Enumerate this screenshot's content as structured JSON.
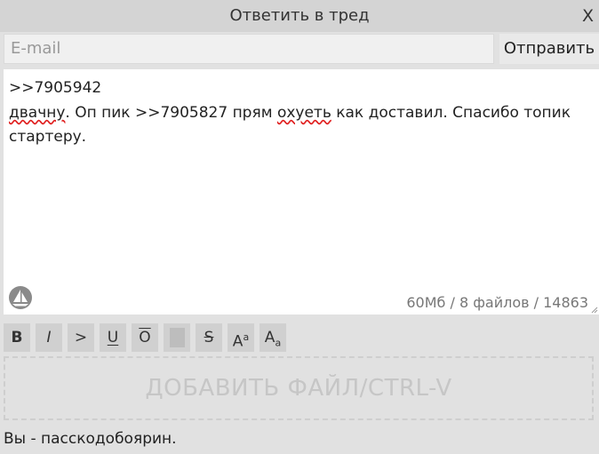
{
  "window": {
    "title": "Ответить в тред",
    "close_label": "X"
  },
  "form": {
    "email_placeholder": "E-mail",
    "email_value": "",
    "send_label": "Отправить",
    "comment": {
      "line1": ">>7905942",
      "word_misspelled_1": "двачну",
      "part2": ". Оп пик >>7905827 прям ",
      "word_misspelled_2": "охуеть",
      "part3": " как доставил. Спасибо топик стартеру."
    },
    "counter": "60Мб / 8 файлов / 14863"
  },
  "toolbar": {
    "bold": "B",
    "italic": "I",
    "quote": ">",
    "underline": "U",
    "overline": "O",
    "spoiler": "",
    "strike": "S",
    "sup_base": "A",
    "sup_mark": "a",
    "sub_base": "A",
    "sub_mark": "a"
  },
  "upload": {
    "label": "ДОБАВИТЬ ФАЙЛ/CTRL-V"
  },
  "footer": {
    "user_text": "Вы - пасскодобоярин."
  }
}
